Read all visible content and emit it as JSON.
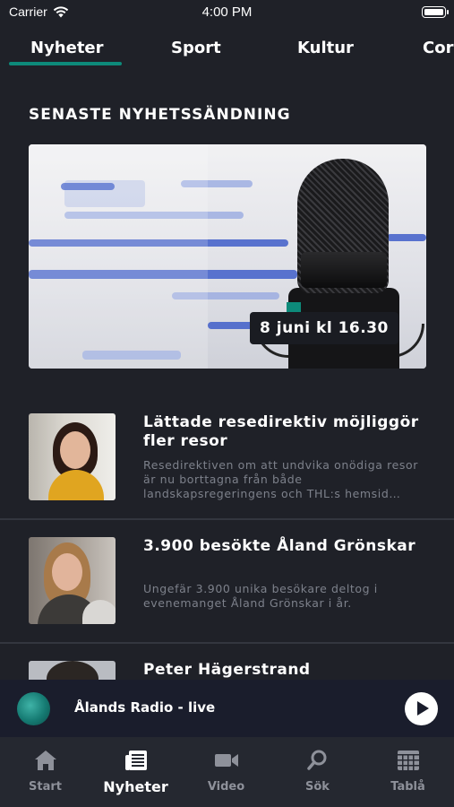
{
  "status_bar": {
    "carrier": "Carrier",
    "time": "4:00 PM"
  },
  "tabs": [
    "Nyheter",
    "Sport",
    "Kultur",
    "Coro"
  ],
  "section_title": "SENASTE NYHETSSÄNDNING",
  "broadcast": {
    "date_label": "8 juni kl 16.30"
  },
  "news": [
    {
      "title": "Lättade resedirektiv möjliggör fler resor",
      "summary": "Resedirektiven om att undvika onödiga resor är nu borttagna från både landskapsregeringens och THL:s hemsid…"
    },
    {
      "title": "3.900 besökte Åland Grönskar",
      "summary": "Ungefär 3.900 unika besökare deltog i evenemanget Åland Grönskar i år."
    },
    {
      "title": "Peter Hägerstrand",
      "summary": ""
    }
  ],
  "player": {
    "title": "Ålands Radio - live"
  },
  "bottom_nav": [
    {
      "label": "Start",
      "icon": "home-icon",
      "active": false
    },
    {
      "label": "Nyheter",
      "icon": "news-icon",
      "active": true
    },
    {
      "label": "Video",
      "icon": "video-icon",
      "active": false
    },
    {
      "label": "Sök",
      "icon": "search-icon",
      "active": false
    },
    {
      "label": "Tablå",
      "icon": "schedule-icon",
      "active": false
    }
  ],
  "colors": {
    "accent": "#0d8a7a",
    "background": "#1f2128",
    "player_bg": "#1a1d2c",
    "nav_bg": "#252830"
  }
}
